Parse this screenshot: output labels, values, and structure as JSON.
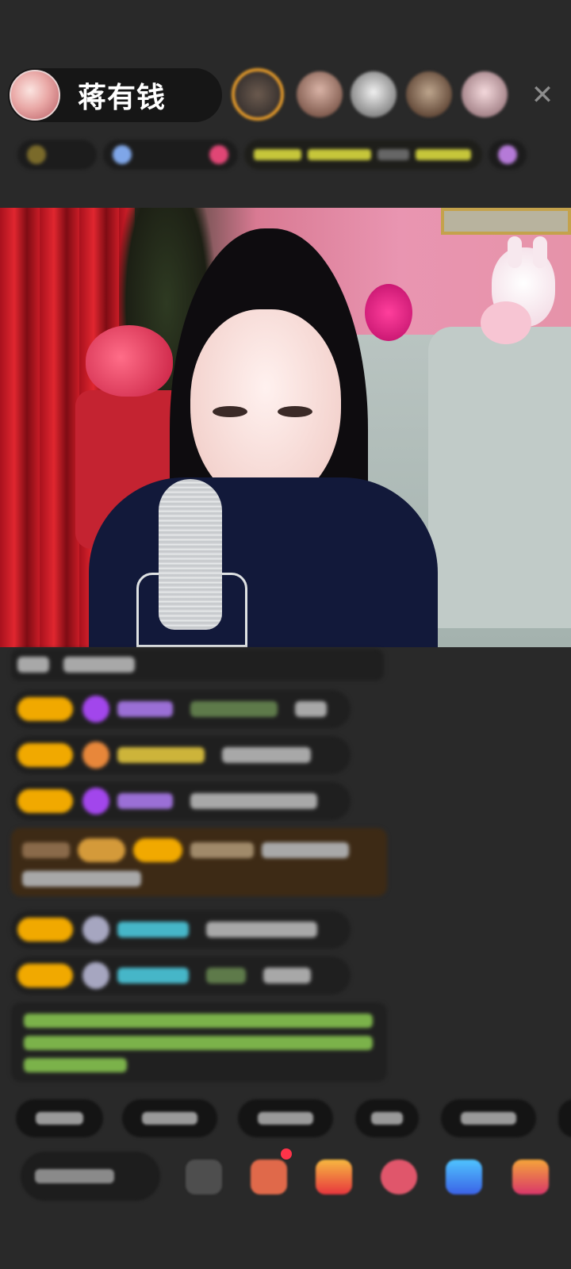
{
  "host": {
    "name": "蒋有钱"
  },
  "viewers": {
    "count_visible": 5
  },
  "colors": {
    "background": "#292929",
    "level_badge": "#f1a900",
    "system_message_bg": "#3d2a15",
    "notice_text": "#7bb24a",
    "name_purple": "#9b6fd6",
    "name_yellow": "#cdb43a",
    "name_cyan": "#46b6c8"
  },
  "icons": {
    "close": "close-icon",
    "gift_box": "gift-box-icon",
    "emoji": "emoji-icon"
  }
}
